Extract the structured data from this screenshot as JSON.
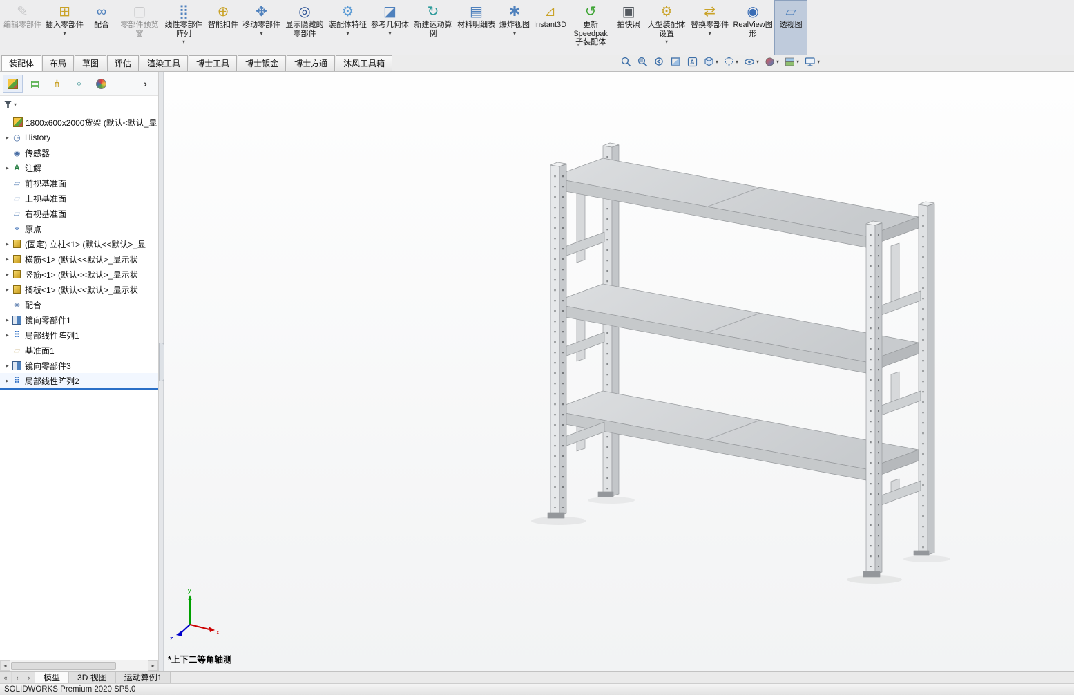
{
  "toolbar": {
    "buttons": [
      {
        "label": "编辑零部件",
        "icon": "edit-component",
        "glyph": "✎",
        "disabled": true,
        "caret": false
      },
      {
        "label": "插入零部件",
        "icon": "insert-components",
        "glyph": "⊞",
        "disabled": false,
        "caret": true
      },
      {
        "label": "配合",
        "icon": "mate",
        "glyph": "∞",
        "disabled": false,
        "caret": false
      },
      {
        "label": "零部件预览窗",
        "icon": "component-preview-window",
        "glyph": "▢",
        "disabled": true,
        "caret": false
      },
      {
        "label": "线性零部件阵列",
        "icon": "linear-component-pattern",
        "glyph": "⣿",
        "disabled": false,
        "caret": true
      },
      {
        "label": "智能扣件",
        "icon": "smart-fasteners",
        "glyph": "⊕",
        "disabled": false,
        "caret": false
      },
      {
        "label": "移动零部件",
        "icon": "move-component",
        "glyph": "✥",
        "disabled": false,
        "caret": true
      },
      {
        "label": "显示隐藏的零部件",
        "icon": "show-hidden-components",
        "glyph": "◎",
        "disabled": false,
        "caret": false
      },
      {
        "label": "装配体特征",
        "icon": "assembly-features",
        "glyph": "⚙",
        "disabled": false,
        "caret": true
      },
      {
        "label": "参考几何体",
        "icon": "reference-geometry",
        "glyph": "◪",
        "disabled": false,
        "caret": true
      },
      {
        "label": "新建运动算例",
        "icon": "new-motion-study",
        "glyph": "↻",
        "disabled": false,
        "caret": false
      },
      {
        "label": "材料明细表",
        "icon": "bill-of-materials",
        "glyph": "▤",
        "disabled": false,
        "caret": false
      },
      {
        "label": "爆炸视图",
        "icon": "exploded-view",
        "glyph": "✱",
        "disabled": false,
        "caret": true
      },
      {
        "label": "Instant3D",
        "icon": "instant3d",
        "glyph": "⊿",
        "disabled": false,
        "caret": false
      },
      {
        "label": "更新Speedpak子装配体",
        "icon": "update-speedpak",
        "glyph": "↺",
        "disabled": false,
        "caret": false
      },
      {
        "label": "拍快照",
        "icon": "take-snapshot",
        "glyph": "▣",
        "disabled": false,
        "caret": false
      },
      {
        "label": "大型装配体设置",
        "icon": "large-assembly-settings",
        "glyph": "⚙",
        "disabled": false,
        "caret": true
      },
      {
        "label": "替换零部件",
        "icon": "replace-components",
        "glyph": "⇄",
        "disabled": false,
        "caret": true
      },
      {
        "label": "RealView图形",
        "icon": "realview-graphics",
        "glyph": "◉",
        "disabled": false,
        "caret": false
      },
      {
        "label": "透视图",
        "icon": "perspective",
        "glyph": "▱",
        "disabled": false,
        "caret": false,
        "active": true
      }
    ]
  },
  "tabs": {
    "items": [
      "装配体",
      "布局",
      "草图",
      "评估",
      "渲染工具",
      "博士工具",
      "博士钣金",
      "博士方通",
      "沐风工具箱"
    ],
    "active": "装配体"
  },
  "headsup": {
    "icons": [
      "zoom-to-fit",
      "zoom-area",
      "previous-view",
      "section-view",
      "dynamic-annotation-views",
      "view-orientation",
      "display-style",
      "hide-show-items",
      "edit-appearance",
      "apply-scene",
      "view-settings"
    ]
  },
  "panel_tabs": {
    "icons": [
      "feature-manager",
      "property-manager",
      "configuration-manager",
      "dimxpert-manager",
      "display-manager",
      "expand-panel"
    ]
  },
  "feature_tree": {
    "items": [
      {
        "label": "1800x600x2000货架 (默认<默认_显",
        "icon": "assembly",
        "arrow": false,
        "selected": false
      },
      {
        "label": "History",
        "icon": "history",
        "arrow": true,
        "selected": false
      },
      {
        "label": "传感器",
        "icon": "sensors",
        "arrow": false,
        "selected": false
      },
      {
        "label": "注解",
        "icon": "annotations",
        "arrow": true,
        "selected": false
      },
      {
        "label": "前视基准面",
        "icon": "plane",
        "arrow": false,
        "selected": false
      },
      {
        "label": "上视基准面",
        "icon": "plane",
        "arrow": false,
        "selected": false
      },
      {
        "label": "右视基准面",
        "icon": "plane",
        "arrow": false,
        "selected": false
      },
      {
        "label": "原点",
        "icon": "origin",
        "arrow": false,
        "selected": false
      },
      {
        "label": "(固定) 立柱<1> (默认<<默认>_显",
        "icon": "part",
        "arrow": true,
        "selected": false
      },
      {
        "label": "横筋<1> (默认<<默认>_显示状",
        "icon": "part",
        "arrow": true,
        "selected": false
      },
      {
        "label": "竖筋<1> (默认<<默认>_显示状",
        "icon": "part",
        "arrow": true,
        "selected": false
      },
      {
        "label": "搁板<1> (默认<<默认>_显示状",
        "icon": "part",
        "arrow": true,
        "selected": false
      },
      {
        "label": "配合",
        "icon": "mates",
        "arrow": false,
        "selected": false
      },
      {
        "label": "镜向零部件1",
        "icon": "mirror-component",
        "arrow": true,
        "selected": false
      },
      {
        "label": "局部线性阵列1",
        "icon": "linear-pattern",
        "arrow": true,
        "selected": false
      },
      {
        "label": "基准面1",
        "icon": "plane1",
        "arrow": false,
        "selected": false
      },
      {
        "label": "镜向零部件3",
        "icon": "mirror-component",
        "arrow": true,
        "selected": false
      },
      {
        "label": "局部线性阵列2",
        "icon": "linear-pattern",
        "arrow": true,
        "selected": true
      }
    ]
  },
  "viewport": {
    "view_label": "*上下二等角轴测",
    "triad": {
      "x": "x",
      "y": "y",
      "z": "z"
    }
  },
  "bottom_tabs": {
    "items": [
      "模型",
      "3D 视图",
      "运动算例1"
    ],
    "active": "模型"
  },
  "status_bar": {
    "text": "SOLIDWORKS Premium 2020 SP5.0"
  },
  "colors": {
    "selection": "#2a6fc7",
    "toolbar_active_bg": "#bfcbdc",
    "model_steel_light": "#dcdee0",
    "model_steel_dark": "#c3c6c9"
  }
}
